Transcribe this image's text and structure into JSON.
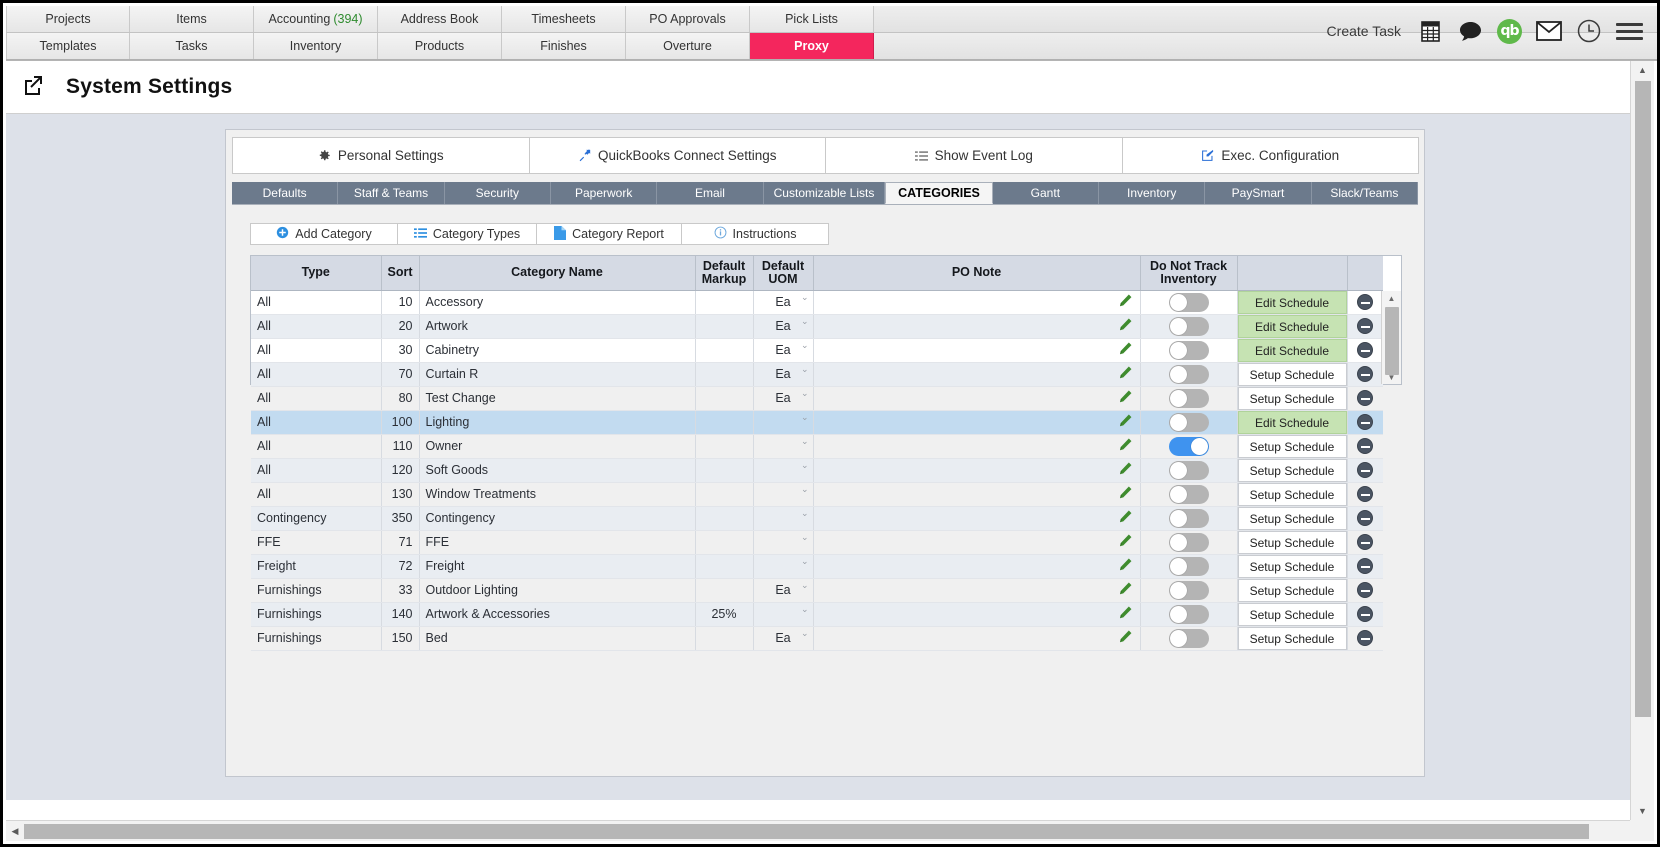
{
  "nav": {
    "row1": [
      {
        "label": "Projects",
        "count": ""
      },
      {
        "label": "Items",
        "count": ""
      },
      {
        "label": "Accounting",
        "count": "(394)"
      },
      {
        "label": "Address Book",
        "count": ""
      },
      {
        "label": "Timesheets",
        "count": ""
      },
      {
        "label": "PO Approvals",
        "count": ""
      },
      {
        "label": "Pick Lists",
        "count": ""
      }
    ],
    "row2": [
      {
        "label": "Templates",
        "active": false
      },
      {
        "label": "Tasks",
        "active": false
      },
      {
        "label": "Inventory",
        "active": false
      },
      {
        "label": "Products",
        "active": false
      },
      {
        "label": "Finishes",
        "active": false
      },
      {
        "label": "Overture",
        "active": false
      },
      {
        "label": "Proxy",
        "active": true
      }
    ],
    "accent_active": "#f4265d",
    "accent_count": "#2e8b2e"
  },
  "header": {
    "create_task_label": "Create Task",
    "icons": [
      "report-icon",
      "chat-icon",
      "quickbooks-icon",
      "mail-icon",
      "clock-icon",
      "hamburger-menu-icon"
    ],
    "qb_label": "qb"
  },
  "page": {
    "title": "System Settings",
    "open_external_icon": "external-link-icon"
  },
  "settings_buttons": [
    {
      "label": "Personal Settings",
      "icon": "gear-icon"
    },
    {
      "label": "QuickBooks Connect Settings",
      "icon": "arrow-expand-icon"
    },
    {
      "label": "Show Event Log",
      "icon": "list-icon"
    },
    {
      "label": "Exec. Configuration",
      "icon": "edit-square-icon"
    }
  ],
  "tabs": [
    {
      "label": "Defaults",
      "active": false
    },
    {
      "label": "Staff & Teams",
      "active": false
    },
    {
      "label": "Security",
      "active": false
    },
    {
      "label": "Paperwork",
      "active": false
    },
    {
      "label": "Email",
      "active": false
    },
    {
      "label": "Customizable Lists",
      "active": false
    },
    {
      "label": "CATEGORIES",
      "active": true
    },
    {
      "label": "Gantt",
      "active": false
    },
    {
      "label": "Inventory",
      "active": false
    },
    {
      "label": "PaySmart",
      "active": false
    },
    {
      "label": "Slack/Teams",
      "active": false
    }
  ],
  "action_buttons": [
    {
      "label": "Add Category",
      "icon": "plus-circle-icon"
    },
    {
      "label": "Category Types",
      "icon": "list-icon"
    },
    {
      "label": "Category Report",
      "icon": "document-icon"
    },
    {
      "label": "Instructions",
      "icon": "info-circle-icon"
    }
  ],
  "table": {
    "columns": [
      "Type",
      "Sort",
      "Category Name",
      "Default Markup",
      "Default UOM",
      "PO Note",
      "Do Not Track Inventory",
      ""
    ],
    "rows": [
      {
        "type": "All",
        "sort": "10",
        "name": "Accessory",
        "markup": "",
        "uom": "Ea",
        "po_note": "",
        "track": false,
        "schedule": "Edit Schedule",
        "schedule_state": "edit",
        "selected": false
      },
      {
        "type": "All",
        "sort": "20",
        "name": "Artwork",
        "markup": "",
        "uom": "Ea",
        "po_note": "",
        "track": false,
        "schedule": "Edit Schedule",
        "schedule_state": "edit",
        "selected": false
      },
      {
        "type": "All",
        "sort": "30",
        "name": "Cabinetry",
        "markup": "",
        "uom": "Ea",
        "po_note": "",
        "track": false,
        "schedule": "Edit Schedule",
        "schedule_state": "edit",
        "selected": false
      },
      {
        "type": "All",
        "sort": "70",
        "name": "Curtain R",
        "markup": "",
        "uom": "Ea",
        "po_note": "",
        "track": false,
        "schedule": "Setup Schedule",
        "schedule_state": "setup",
        "selected": false
      },
      {
        "type": "All",
        "sort": "80",
        "name": "Test Change",
        "markup": "",
        "uom": "Ea",
        "po_note": "",
        "track": false,
        "schedule": "Setup Schedule",
        "schedule_state": "setup",
        "selected": false
      },
      {
        "type": "All",
        "sort": "100",
        "name": "Lighting",
        "markup": "",
        "uom": "",
        "po_note": "",
        "track": false,
        "schedule": "Edit Schedule",
        "schedule_state": "edit",
        "selected": true
      },
      {
        "type": "All",
        "sort": "110",
        "name": "Owner",
        "markup": "",
        "uom": "",
        "po_note": "",
        "track": true,
        "schedule": "Setup Schedule",
        "schedule_state": "setup",
        "selected": false
      },
      {
        "type": "All",
        "sort": "120",
        "name": "Soft Goods",
        "markup": "",
        "uom": "",
        "po_note": "",
        "track": false,
        "schedule": "Setup Schedule",
        "schedule_state": "setup",
        "selected": false
      },
      {
        "type": "All",
        "sort": "130",
        "name": "Window Treatments",
        "markup": "",
        "uom": "",
        "po_note": "",
        "track": false,
        "schedule": "Setup Schedule",
        "schedule_state": "setup",
        "selected": false
      },
      {
        "type": "Contingency",
        "sort": "350",
        "name": "Contingency",
        "markup": "",
        "uom": "",
        "po_note": "",
        "track": false,
        "schedule": "Setup Schedule",
        "schedule_state": "setup",
        "selected": false
      },
      {
        "type": "FFE",
        "sort": "71",
        "name": "FFE",
        "markup": "",
        "uom": "",
        "po_note": "",
        "track": false,
        "schedule": "Setup Schedule",
        "schedule_state": "setup",
        "selected": false
      },
      {
        "type": "Freight",
        "sort": "72",
        "name": "Freight",
        "markup": "",
        "uom": "",
        "po_note": "",
        "track": false,
        "schedule": "Setup Schedule",
        "schedule_state": "setup",
        "selected": false
      },
      {
        "type": "Furnishings",
        "sort": "33",
        "name": "Outdoor Lighting",
        "markup": "",
        "uom": "Ea",
        "po_note": "",
        "track": false,
        "schedule": "Setup Schedule",
        "schedule_state": "setup",
        "selected": false
      },
      {
        "type": "Furnishings",
        "sort": "140",
        "name": "Artwork & Accessories",
        "markup": "25%",
        "uom": "",
        "po_note": "",
        "track": false,
        "schedule": "Setup Schedule",
        "schedule_state": "setup",
        "selected": false
      },
      {
        "type": "Furnishings",
        "sort": "150",
        "name": "Bed",
        "markup": "",
        "uom": "Ea",
        "po_note": "",
        "track": false,
        "schedule": "Setup Schedule",
        "schedule_state": "setup",
        "selected": false
      }
    ]
  },
  "colors": {
    "tab_inactive_bg": "#6c7a8c",
    "table_header_bg": "#d5dae4",
    "row_alt_bg": "#e9edf2",
    "row_selected_bg": "#c2dbf0",
    "edit_schedule_bg": "#c6e3b3",
    "toggle_on": "#3f93ef",
    "page_bg": "#dde1e9"
  }
}
